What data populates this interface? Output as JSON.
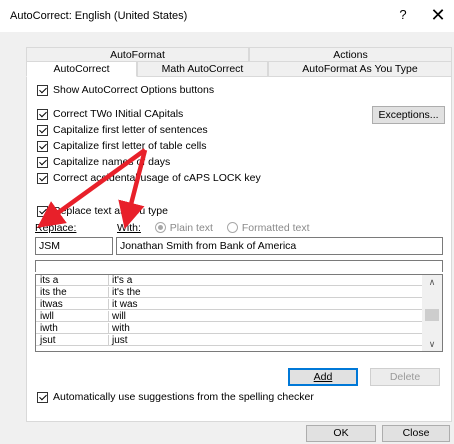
{
  "window": {
    "title": "AutoCorrect: English (United States)",
    "help": "?",
    "close": "✕"
  },
  "tabs_row1": [
    "AutoFormat",
    "Actions"
  ],
  "tabs_row2": [
    "AutoCorrect",
    "Math AutoCorrect",
    "AutoFormat As You Type"
  ],
  "options": {
    "show_buttons": "Show AutoCorrect Options buttons",
    "two_initial": "Correct TWo INitial CApitals",
    "cap_sentences": "Capitalize first letter of sentences",
    "cap_table": "Capitalize first letter of table cells",
    "cap_days": "Capitalize names of days",
    "caps_lock": "Correct accidental usage of cAPS LOCK key",
    "exceptions_button": "Exceptions..."
  },
  "replace_section": {
    "replace_checkbox": "Replace text as you type",
    "replace_label": "Replace:",
    "with_label": "With:",
    "plain_text": "Plain text",
    "formatted_text": "Formatted text",
    "replace_value": "JSM",
    "with_value": "Jonathan Smith from Bank of America"
  },
  "list": [
    [
      "its a",
      "it's a"
    ],
    [
      "its the",
      "it's the"
    ],
    [
      "itwas",
      "it was"
    ],
    [
      "iwll",
      "will"
    ],
    [
      "iwth",
      "with"
    ],
    [
      "jsut",
      "just"
    ]
  ],
  "buttons": {
    "add": "Add",
    "delete": "Delete",
    "ok": "OK",
    "close": "Close"
  },
  "suggestions": "Automatically use suggestions from the spelling checker",
  "annotation_color": "#e8202a"
}
